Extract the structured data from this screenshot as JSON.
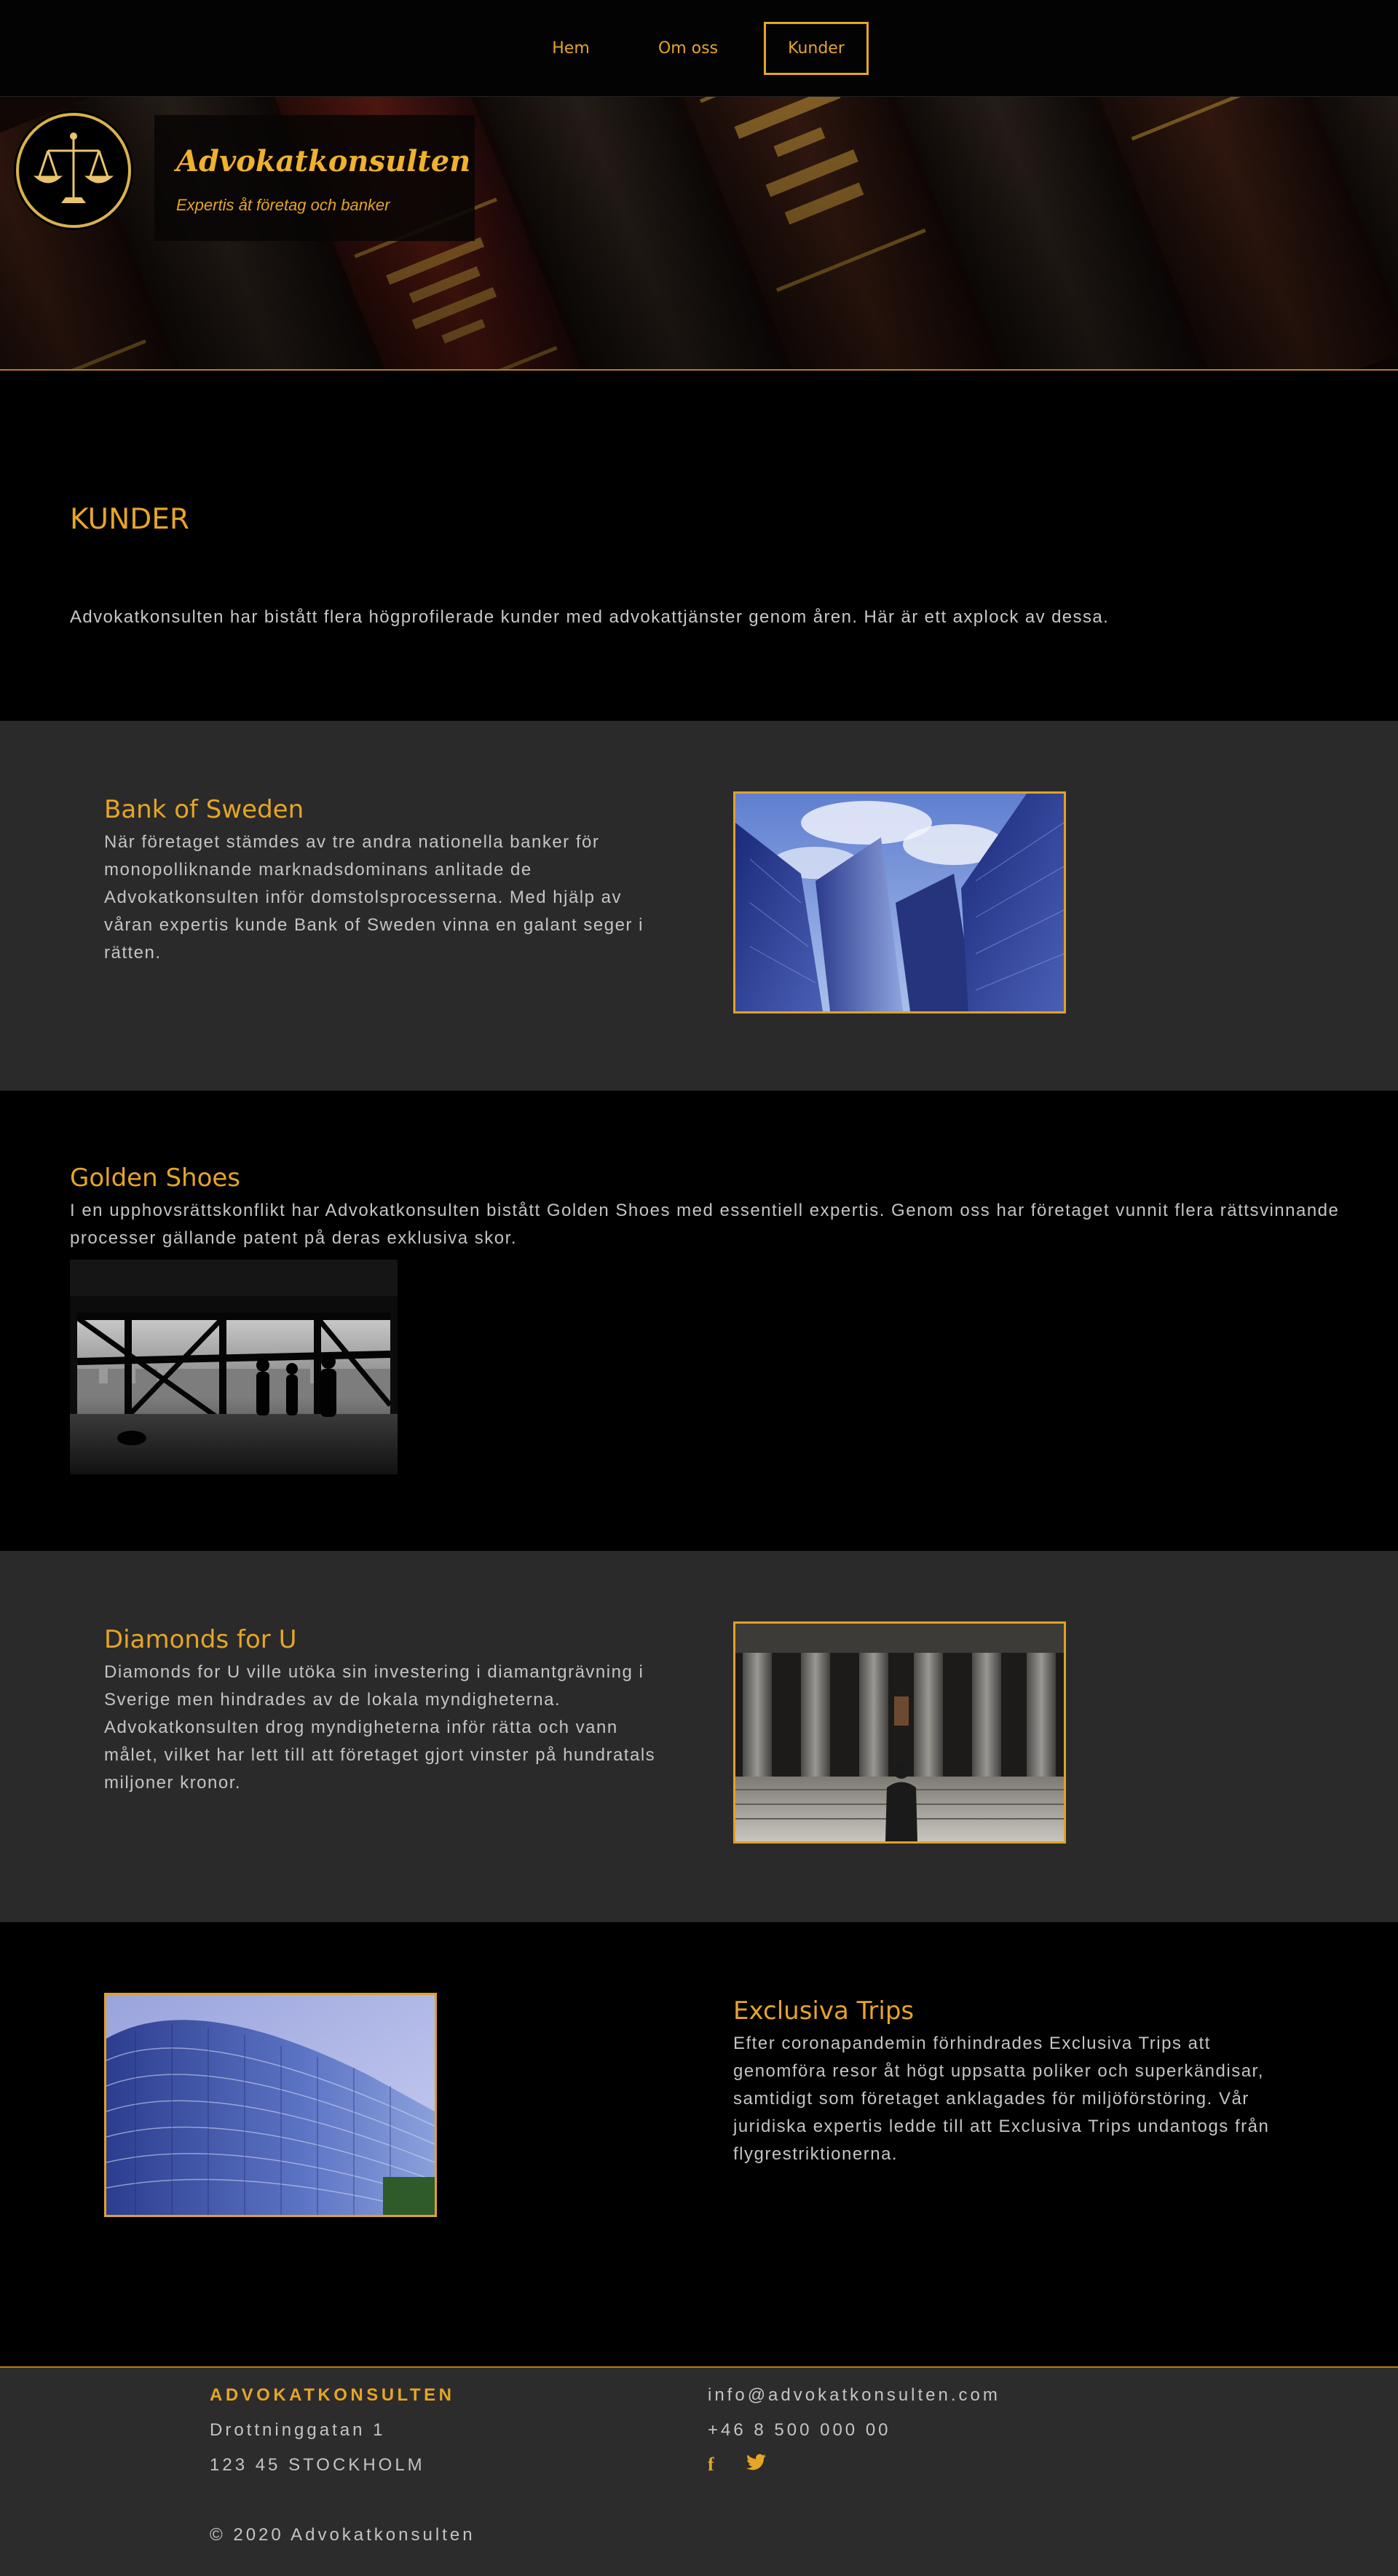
{
  "nav": {
    "items": [
      {
        "label": "Hem"
      },
      {
        "label": "Om oss"
      },
      {
        "label": "Kunder",
        "active": true
      }
    ]
  },
  "brand": {
    "name": "Advokatkonsulten",
    "tagline": "Expertis åt företag och banker",
    "logo_icon": "scales-of-justice-icon"
  },
  "intro": {
    "heading": "KUNDER",
    "text": "Advokatkonsulten har bistått flera högprofilerade kunder med advokattjänster genom åren. Här är ett axplock av dessa."
  },
  "clients": [
    {
      "title": "Bank of Sweden",
      "text": "När företaget stämdes av tre andra nationella banker för monopolliknande marknadsdominans anlitade de Advokatkonsulten inför domstolsprocesserna. Med hjälp av våran expertis kunde Bank of Sweden vinna en galant seger i rätten.",
      "image": "skyscrapers-photo"
    },
    {
      "title": "Golden Shoes",
      "text": "I en upphovsrättskonflikt har Advokatkonsulten bistått Golden Shoes med essentiell expertis. Genom oss har företaget vunnit flera rättsvinnande processer gällande patent på deras exklusiva skor.",
      "image": "office-window-photo"
    },
    {
      "title": "Diamonds for U",
      "text": "Diamonds for U ville utöka sin investering i diamantgrävning i Sverige men hindrades av de lokala myndigheterna. Advokatkonsulten drog myndigheterna inför rätta och vann målet, vilket har lett till att företaget gjort vinster på hundratals miljoner kronor.",
      "image": "building-entrance-photo"
    },
    {
      "title": "Exclusiva Trips",
      "text": "Efter coronapandemin förhindrades Exclusiva Trips att genomföra resor åt högt uppsatta poliker och superkändisar, samtidigt som företaget anklagades för miljöförstöring. Vår juridiska expertis ledde till att Exclusiva Trips undantogs från flygrestriktionerna.",
      "image": "glass-building-photo"
    }
  ],
  "footer": {
    "brand": "ADVOKATKONSULTEN",
    "street": "Drottninggatan 1",
    "city": "123 45 STOCKHOLM",
    "email": "info@advokatkonsulten.com",
    "phone": "+46 8 500 000 00",
    "social": [
      {
        "name": "facebook-icon",
        "glyph": "f"
      },
      {
        "name": "twitter-icon",
        "glyph": "🐦"
      }
    ],
    "copyright": "© 2020 Advokatkonsulten"
  },
  "colors": {
    "accent": "#e6a526",
    "background": "#000000",
    "section_dark": "#2a2a2a",
    "text": "#c4c4c4"
  }
}
